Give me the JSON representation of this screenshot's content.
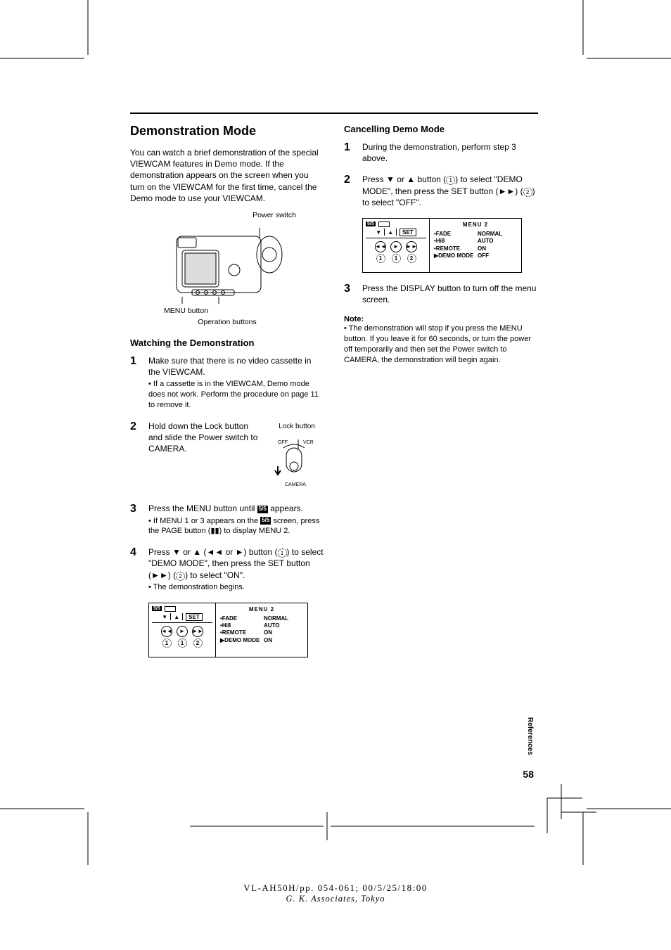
{
  "heading": "Demonstration Mode",
  "intro": "You can watch a brief demonstration of the special VIEWCAM features in Demo mode. If the demonstration appears on the screen when you turn on the VIEWCAM for the first time, cancel the Demo mode to use your VIEWCAM.",
  "fig1": {
    "power_switch": "Power switch",
    "menu_button": "MENU button",
    "operation_buttons": "Operation buttons"
  },
  "watch_heading": "Watching the Demonstration",
  "steps_watch": {
    "s1": {
      "text": "Make sure that there is no video cassette in the VIEWCAM.",
      "bullet": "• If a cassette is in the VIEWCAM, Demo mode does not work. Perform the procedure on page 11 to remove it."
    },
    "s2": {
      "text": "Hold down the Lock button and slide the Power switch to CAMERA.",
      "lock_label": "Lock button",
      "off": "OFF",
      "vcr": "VCR",
      "camera": "CAMERA"
    },
    "s3": {
      "pre": "Press the MENU button until ",
      "badge": "5/5",
      "post": " appears.",
      "bullet_pre": "• If MENU 1 or 3 appears on the ",
      "bullet_post": " screen, press the PAGE button (",
      "bullet_post2": ") to display MENU 2."
    },
    "s4": {
      "pre": "Press ",
      "mid1": " or ",
      "mid2": " (",
      "mid3": " or ",
      "mid4": ") button (",
      "mid5": ") to select \"DEMO MODE\", then press the SET button (",
      "mid6": ") (",
      "mid7": ") to select \"ON\".",
      "bullet": "• The demonstration begins."
    }
  },
  "menu_panel1": {
    "set": "SET",
    "title": "MENU  2",
    "rows": [
      {
        "k": "•FADE",
        "v": "NORMAL"
      },
      {
        "k": "•Hi8",
        "v": "AUTO"
      },
      {
        "k": "•REMOTE",
        "v": "ON"
      },
      {
        "k": "▶DEMO MODE",
        "v": "ON"
      }
    ]
  },
  "cancel_heading": "Cancelling Demo Mode",
  "steps_cancel": {
    "s1": "During the demonstration, perform step 3 above.",
    "s2": {
      "pre": "Press ",
      "mid1": " or ",
      "mid2": " button (",
      "mid3": ") to select \"DEMO MODE\", then press the SET button (",
      "mid4": ") (",
      "mid5": ") to select \"OFF\"."
    },
    "s3": "Press the DISPLAY button to turn off the menu screen."
  },
  "menu_panel2": {
    "set": "SET",
    "title": "MENU  2",
    "rows": [
      {
        "k": "•FADE",
        "v": "NORMAL"
      },
      {
        "k": "•Hi8",
        "v": "AUTO"
      },
      {
        "k": "•REMOTE",
        "v": "ON"
      },
      {
        "k": "▶DEMO MODE",
        "v": "OFF"
      }
    ]
  },
  "note_label": "Note:",
  "note_text": "• The demonstration will stop if you press the MENU button. If you leave it for 60 seconds, or turn the power off temporarily and then set the Power switch to CAMERA, the demonstration will begin again.",
  "side_tab": "References",
  "page_num": "58",
  "footer_l1": "VL-AH50H/pp. 054-061; 00/5/25/18:00",
  "footer_l2": "G. K. Associates, Tokyo"
}
